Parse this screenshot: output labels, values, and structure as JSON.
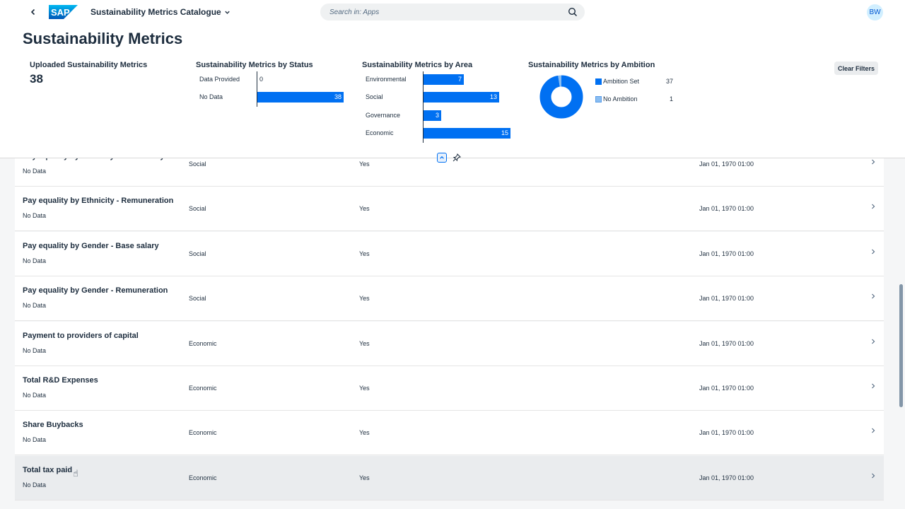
{
  "shell": {
    "app_title": "Sustainability Metrics Catalogue",
    "search_placeholder": "Search in: Apps",
    "avatar_initials": "BW",
    "brand_color": "#0070f2"
  },
  "header": {
    "page_title": "Sustainability Metrics",
    "clear_filters_label": "Clear Filters",
    "uploaded": {
      "title": "Uploaded Sustainability Metrics",
      "value": "38"
    },
    "by_status": {
      "title": "Sustainability Metrics by Status",
      "items": [
        {
          "label": "Data Provided",
          "value": 0
        },
        {
          "label": "No Data",
          "value": 38
        }
      ]
    },
    "by_area": {
      "title": "Sustainability Metrics by Area",
      "items": [
        {
          "label": "Environmental",
          "value": 7
        },
        {
          "label": "Social",
          "value": 13
        },
        {
          "label": "Governance",
          "value": 3
        },
        {
          "label": "Economic",
          "value": 15
        }
      ]
    },
    "by_ambition": {
      "title": "Sustainability Metrics by Ambition",
      "items": [
        {
          "label": "Ambition Set",
          "value": 37,
          "color": "#0070f2"
        },
        {
          "label": "No Ambition",
          "value": 1,
          "color": "#89bdf2"
        }
      ]
    }
  },
  "table": {
    "rows": [
      {
        "title": "Pay equality by Ethnicity - Base salary",
        "status": "No Data",
        "area": "Social",
        "ambition": "Yes",
        "date": "Jan 01, 1970 01:00"
      },
      {
        "title": "Pay equality by Ethnicity - Remuneration",
        "status": "No Data",
        "area": "Social",
        "ambition": "Yes",
        "date": "Jan 01, 1970 01:00"
      },
      {
        "title": "Pay equality by Gender - Base salary",
        "status": "No Data",
        "area": "Social",
        "ambition": "Yes",
        "date": "Jan 01, 1970 01:00"
      },
      {
        "title": "Pay equality by Gender - Remuneration",
        "status": "No Data",
        "area": "Social",
        "ambition": "Yes",
        "date": "Jan 01, 1970 01:00"
      },
      {
        "title": "Payment to providers of capital",
        "status": "No Data",
        "area": "Economic",
        "ambition": "Yes",
        "date": "Jan 01, 1970 01:00"
      },
      {
        "title": "Total R&D Expenses",
        "status": "No Data",
        "area": "Economic",
        "ambition": "Yes",
        "date": "Jan 01, 1970 01:00"
      },
      {
        "title": "Share Buybacks",
        "status": "No Data",
        "area": "Economic",
        "ambition": "Yes",
        "date": "Jan 01, 1970 01:00"
      },
      {
        "title": "Total tax paid",
        "status": "No Data",
        "area": "Economic",
        "ambition": "Yes",
        "date": "Jan 01, 1970 01:00"
      }
    ]
  }
}
